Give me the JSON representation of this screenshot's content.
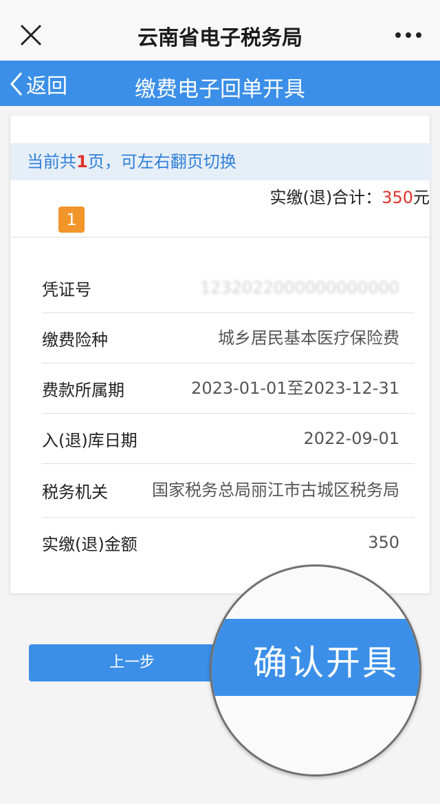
{
  "topbar": {
    "title": "云南省电子税务局",
    "close_icon": "close-icon",
    "more_icon": "more-icon"
  },
  "navbar": {
    "back_label": "返回",
    "title": "缴费电子回单开具",
    "color": "#3b8fe8"
  },
  "pager": {
    "hint_prefix": "当前共",
    "page_count": "1",
    "hint_suffix": "页，可左右翻页切换",
    "current_page": "1"
  },
  "total": {
    "label": "实缴(退)合计：",
    "amount": "350",
    "unit": "元"
  },
  "details": [
    {
      "label": "凭证号",
      "value": "1232022000000000000"
    },
    {
      "label": "缴费险种",
      "value": "城乡居民基本医疗保险费"
    },
    {
      "label": "费款所属期",
      "value": "2023-01-01至2023-12-31"
    },
    {
      "label": "入(退)库日期",
      "value": "2022-09-01"
    },
    {
      "label": "税务机关",
      "value": "国家税务总局丽江市古城区税务局"
    },
    {
      "label": "实缴(退)金额",
      "value": "350"
    }
  ],
  "buttons": {
    "prev_label": "上一步",
    "confirm_label": "确认开具"
  },
  "colors": {
    "accent": "#3b8fe8",
    "highlight": "#e0312b",
    "badge": "#f2952b"
  }
}
